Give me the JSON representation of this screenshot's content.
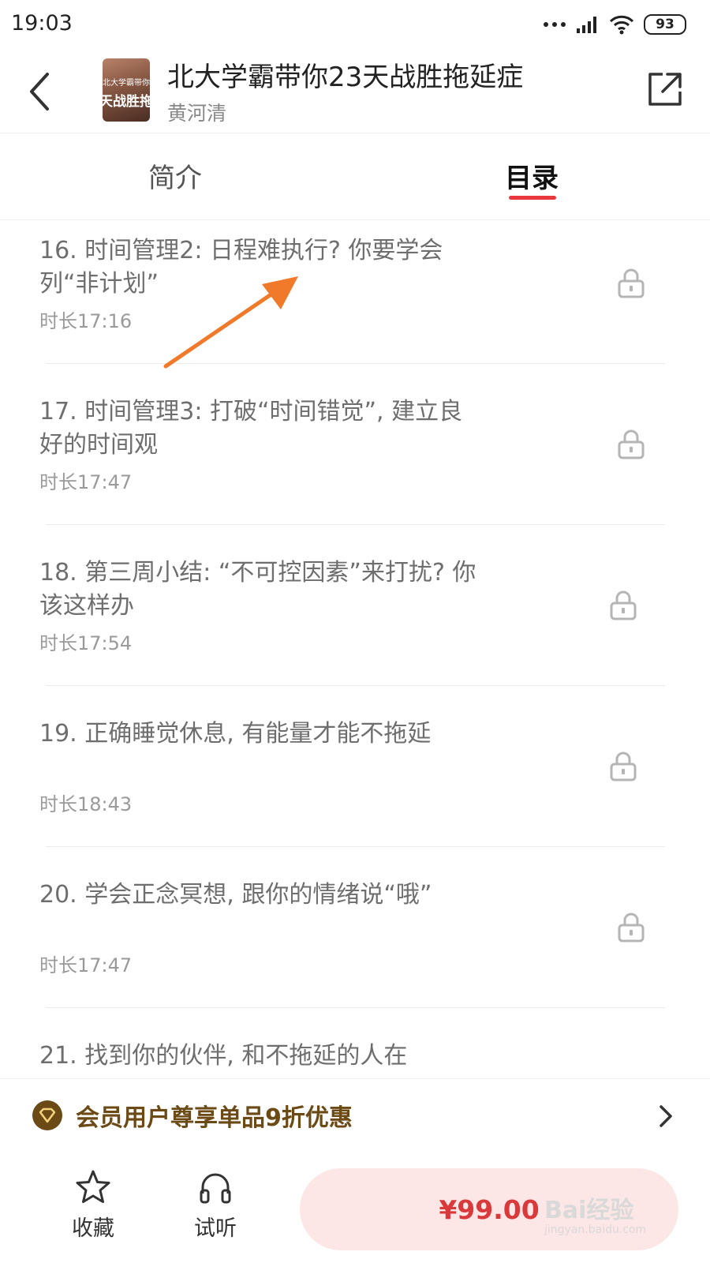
{
  "status_bar": {
    "time": "19:03",
    "battery": "93"
  },
  "header": {
    "title": "北大学霸带你23天战胜拖延症",
    "author": "黄河清",
    "cover_line1": "北大学霸带你",
    "cover_line2": "天战胜拖"
  },
  "tabs": [
    {
      "label": "简介",
      "active": false
    },
    {
      "label": "目录",
      "active": true
    }
  ],
  "catalog": {
    "items": [
      {
        "title": "16. 时间管理2: 日程难执行? 你要学会列“非计划”",
        "duration": "时长17:16",
        "locked": true
      },
      {
        "title": "17. 时间管理3: 打破“时间错觉”, 建立良好的时间观",
        "duration": "时长17:47",
        "locked": true
      },
      {
        "title": "18. 第三周小结: “不可控因素”来打扰? 你该这样办",
        "duration": "时长17:54",
        "locked": true
      },
      {
        "title": "19. 正确睡觉休息, 有能量才能不拖延",
        "duration": "时长18:43",
        "locked": true
      },
      {
        "title": "20. 学会正念冥想, 跟你的情绪说“哦”",
        "duration": "时长17:47",
        "locked": true
      },
      {
        "title": "21. 找到你的伙伴, 和不拖延的人在",
        "duration": "",
        "locked": false
      }
    ]
  },
  "member_bar": {
    "text": "会员用户尊享单品9折优惠"
  },
  "bottom_bar": {
    "favorite_label": "收藏",
    "listen_label": "试听",
    "price": "¥99.00"
  },
  "watermark": {
    "text": "Bai经验",
    "sub": "jingyan.baidu.com"
  },
  "colors": {
    "accent": "#e8383d",
    "member_gold": "#6b4a16",
    "buy_bg": "#fde6e6",
    "price": "#d9393b",
    "arrow": "#f07a2a"
  }
}
